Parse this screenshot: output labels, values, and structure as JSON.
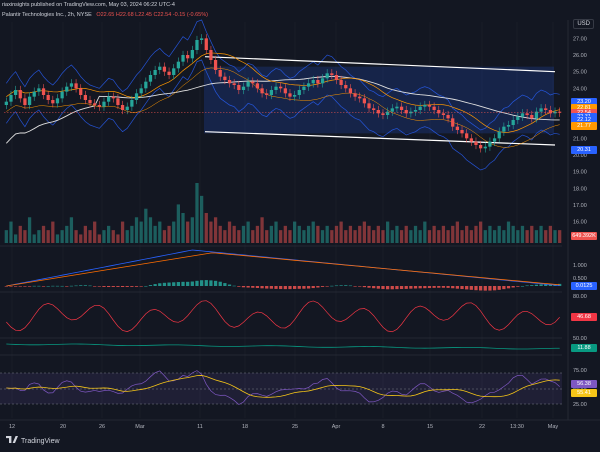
{
  "header": {
    "publisher": "riaxinsights published on TradingView.com, May 03, 2024 06:22 UTC-4",
    "symbol": "Palantir Technologies Inc., 2h, NYSE",
    "ohlc": "O22.65 H22.68 L22.45 C22.54 -0.15 (-0.65%)"
  },
  "currency": "USD",
  "footer": {
    "brand": "TradingView"
  },
  "colors": {
    "background": "#131722",
    "up": "#26a69a",
    "down": "#ef5350",
    "channel": "#ffffff",
    "envelope": "#2962ff",
    "macd_line": "#2962ff",
    "signal_line": "#ff6d00",
    "rsi_line": "#7e57c2",
    "rsi_ma": "#f5c518",
    "cci_line": "#f23645",
    "adx_line": "#089981"
  },
  "chart_data": {
    "type": "candlestick",
    "timeframe": "2h",
    "x_tick_labels": [
      "12",
      "20",
      "26",
      "Mar",
      "11",
      "18",
      "25",
      "Apr",
      "8",
      "15",
      "22",
      "13:30",
      "May"
    ],
    "price_axis": {
      "ylim": [
        15.5,
        27.5
      ],
      "ticks": [
        "27.00",
        "26.00",
        "25.00",
        "24.00",
        "23.00",
        "22.00",
        "21.00",
        "20.00",
        "19.00",
        "18.00",
        "17.00",
        "16.00"
      ]
    },
    "price_labels": [
      {
        "value": 23.2,
        "text": "23.20",
        "color": "#2962ff"
      },
      {
        "value": 22.81,
        "text": "22.81",
        "color": "#ff9800"
      },
      {
        "value": 22.54,
        "text": "22.54",
        "color": "#ef5350"
      },
      {
        "value": 22.31,
        "text": "22.31",
        "color": "#2962ff"
      },
      {
        "value": 22.12,
        "text": "22.12",
        "color": "#2962ff"
      },
      {
        "value": 21.77,
        "text": "21.77",
        "color": "#ff9800"
      },
      {
        "value": 20.31,
        "text": "20.31",
        "color": "#2962ff"
      }
    ],
    "volume_label": "649.392K",
    "closes": [
      23.2,
      23.6,
      23.9,
      23.4,
      23.0,
      23.5,
      23.8,
      24.0,
      23.6,
      23.3,
      23.1,
      23.4,
      23.8,
      24.1,
      24.3,
      24.0,
      23.6,
      23.3,
      23.1,
      23.0,
      22.9,
      23.2,
      23.5,
      23.4,
      23.0,
      22.7,
      22.9,
      23.3,
      23.7,
      24.0,
      24.4,
      24.8,
      25.1,
      25.3,
      25.0,
      24.8,
      25.2,
      25.6,
      26.0,
      25.8,
      26.3,
      26.9,
      27.0,
      26.3,
      25.7,
      25.1,
      24.7,
      24.5,
      24.3,
      24.2,
      23.9,
      24.1,
      24.4,
      24.3,
      24.0,
      23.7,
      23.6,
      23.9,
      24.1,
      24.0,
      23.7,
      23.5,
      23.6,
      23.9,
      24.1,
      24.3,
      24.5,
      24.3,
      24.6,
      24.9,
      24.8,
      24.5,
      24.2,
      24.0,
      23.7,
      23.5,
      23.4,
      23.1,
      22.8,
      22.7,
      22.5,
      22.4,
      22.6,
      22.8,
      22.9,
      22.7,
      22.5,
      22.6,
      22.7,
      22.9,
      23.0,
      22.9,
      22.7,
      22.5,
      22.4,
      22.2,
      21.7,
      21.5,
      21.3,
      21.0,
      20.8,
      20.6,
      20.4,
      20.5,
      20.8,
      21.0,
      21.4,
      21.7,
      21.8,
      22.1,
      22.3,
      22.5,
      22.4,
      22.2,
      22.6,
      22.8,
      22.7,
      22.5,
      22.6,
      22.54
    ],
    "volume": [
      3,
      5,
      2,
      4,
      3,
      6,
      2,
      3,
      4,
      3,
      5,
      2,
      3,
      4,
      6,
      3,
      2,
      4,
      3,
      5,
      2,
      3,
      4,
      3,
      2,
      5,
      3,
      4,
      6,
      5,
      8,
      6,
      4,
      5,
      3,
      4,
      5,
      9,
      7,
      5,
      6,
      14,
      11,
      7,
      5,
      6,
      4,
      3,
      5,
      4,
      3,
      4,
      5,
      3,
      4,
      6,
      3,
      4,
      5,
      3,
      4,
      3,
      5,
      4,
      3,
      4,
      5,
      4,
      3,
      4,
      3,
      4,
      5,
      3,
      4,
      3,
      4,
      5,
      4,
      3,
      4,
      3,
      5,
      3,
      4,
      3,
      4,
      3,
      4,
      3,
      5,
      3,
      4,
      3,
      4,
      3,
      4,
      5,
      3,
      4,
      3,
      4,
      5,
      3,
      4,
      3,
      4,
      3,
      5,
      4,
      3,
      4,
      3,
      4,
      3,
      4,
      3,
      4,
      3,
      3
    ],
    "price_channel": {
      "upper": [
        [
          205,
          25.9
        ],
        [
          555,
          25.0
        ]
      ],
      "lower": [
        [
          205,
          21.4
        ],
        [
          555,
          20.6
        ]
      ]
    },
    "macd": {
      "label": "0.0125",
      "ticks": [
        "1.000",
        "0.500"
      ]
    },
    "cci": {
      "label": "46.68",
      "ticks": [
        "80.00"
      ]
    },
    "adx": {
      "label": "11.88",
      "ticks": [
        "50.00"
      ]
    },
    "rsi": {
      "labels": [
        "56.38",
        "55.41"
      ],
      "ticks": [
        "75.00",
        "50.00",
        "25.00"
      ]
    }
  }
}
